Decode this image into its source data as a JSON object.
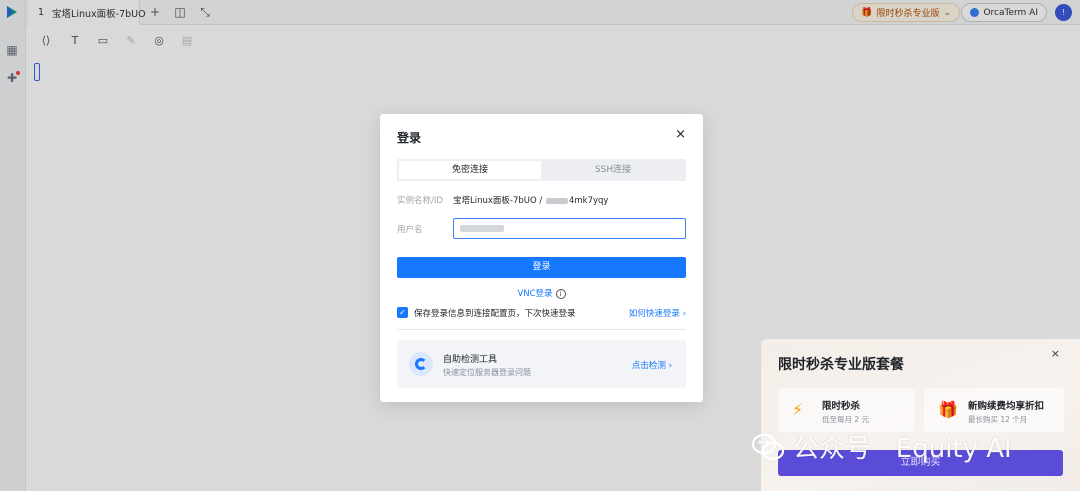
{
  "topbar": {
    "tab_index": "1",
    "tab_title": "宝塔Linux面板-7bUO",
    "promo_label": "限时秒杀专业版",
    "orca_label": "OrcaTerm AI",
    "avatar_initial": "!"
  },
  "modal": {
    "title": "登录",
    "close": "×",
    "tabs": [
      "免密连接",
      "SSH连接"
    ],
    "instance_label": "实例名称/ID",
    "instance_value_prefix": "宝塔Linux面板-7bUO / ",
    "instance_value_suffix": "4mk7yqy",
    "username_label": "用户名",
    "username_value": "",
    "login_button": "登录",
    "vnc_login": "VNC登录",
    "save_text": "保存登录信息到连接配置页，下次快速登录",
    "save_checked": true,
    "quick_login_link": "如何快速登录 ›",
    "tool_title": "自助检测工具",
    "tool_desc": "快速定位服务器登录问题",
    "tool_link": "点击检测 ›"
  },
  "promo": {
    "title": "限时秒杀专业版套餐",
    "close": "×",
    "card1_title": "限时秒杀",
    "card1_sub": "低至每月 2 元",
    "card2_title": "新购续费均享折扣",
    "card2_sub": "最长购买 12 个月",
    "cta": "立即购买"
  },
  "watermark": {
    "text": "公众号 · Equity AI"
  },
  "colors": {
    "primary": "#1677ff",
    "promo_cta": "#5b4cd8"
  }
}
